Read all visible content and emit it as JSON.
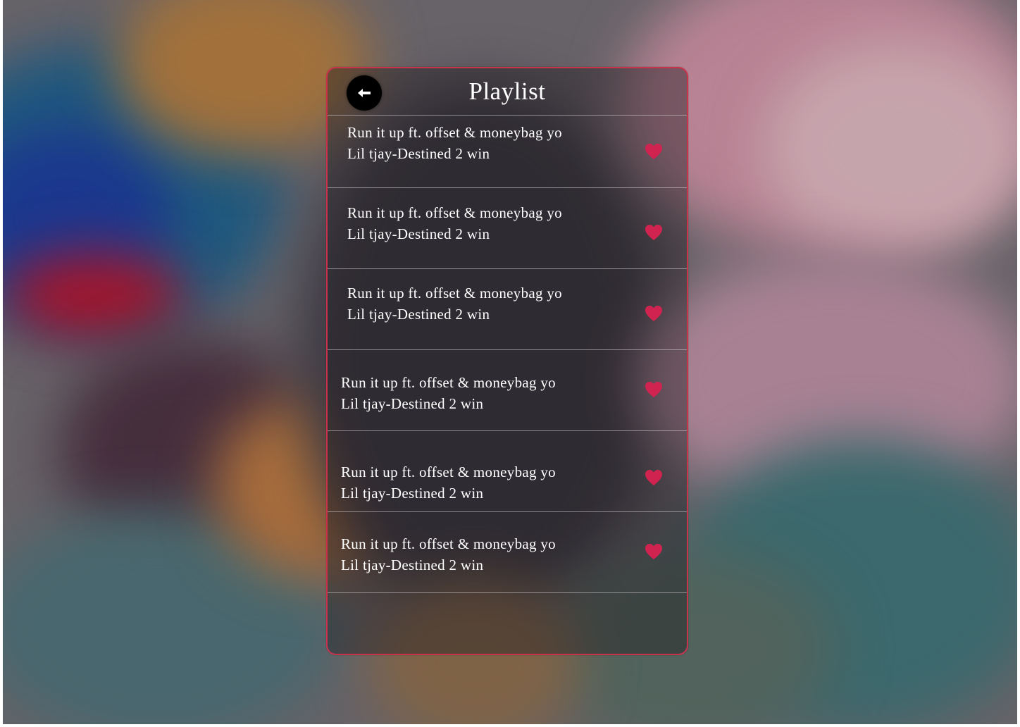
{
  "header": {
    "title": "Playlist",
    "back_icon": "arrow-left-icon"
  },
  "playlist": [
    {
      "title": "Run it up ft. offset & moneybag yo",
      "subtitle": "Lil tjay-Destined 2 win",
      "liked": true
    },
    {
      "title": "Run it up ft. offset & moneybag yo",
      "subtitle": "Lil tjay-Destined 2 win",
      "liked": true
    },
    {
      "title": "Run it up ft. offset & moneybag yo",
      "subtitle": "Lil tjay-Destined 2 win",
      "liked": true
    },
    {
      "title": "Run it up ft. offset & moneybag yo",
      "subtitle": "Lil tjay-Destined 2 win",
      "liked": true
    },
    {
      "title": "Run it up ft. offset & moneybag yo",
      "subtitle": "Lil tjay-Destined 2 win",
      "liked": true
    },
    {
      "title": "Run it up ft. offset & moneybag yo",
      "subtitle": "Lil tjay-Destined 2 win",
      "liked": true
    }
  ],
  "colors": {
    "heart": "#d0234f",
    "card_border_top": "#d0334c",
    "card_border_bottom": "#5c68e0"
  }
}
